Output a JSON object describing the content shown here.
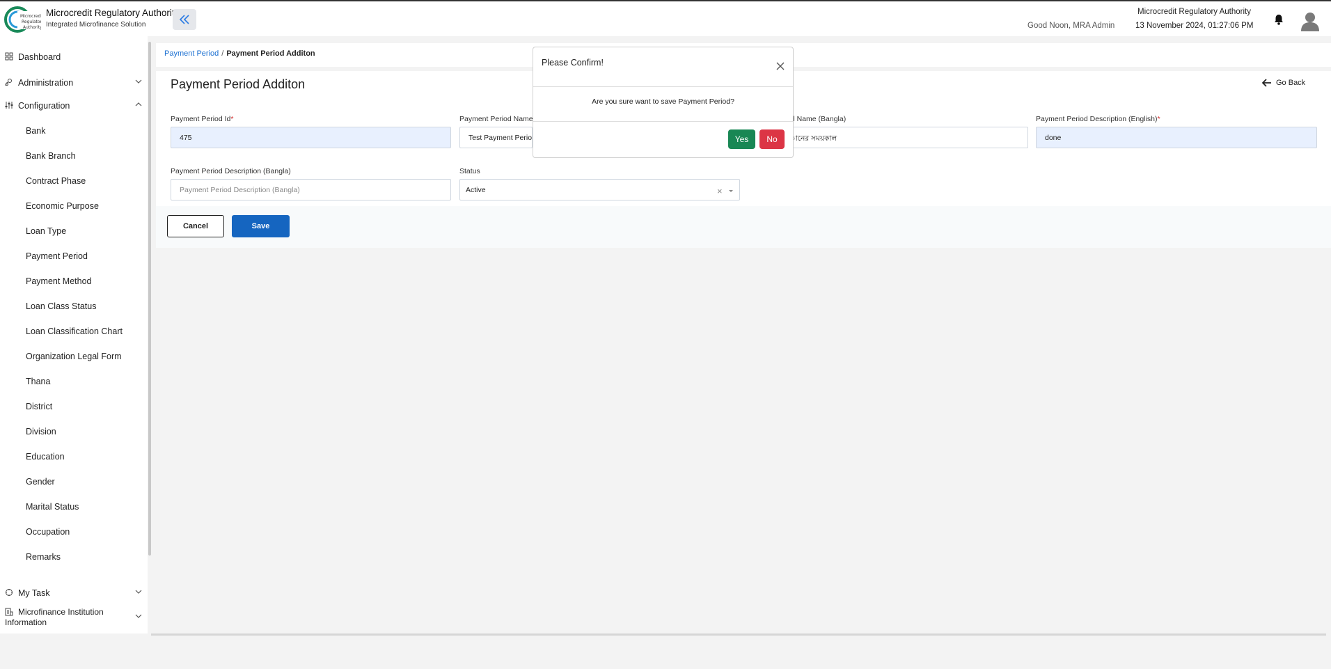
{
  "header": {
    "app_title": "Microcredit Regulatory Authority",
    "app_subtitle": "Integrated Microfinance Solution",
    "greeting": "Good Noon, MRA Admin",
    "org_name": "Microcredit Regulatory Authority",
    "datetime": "13 November 2024, 01:27:06 PM"
  },
  "sidebar": {
    "top": [
      {
        "label": "Dashboard",
        "icon": "dashboard-icon"
      },
      {
        "label": "Administration",
        "icon": "admin-icon"
      },
      {
        "label": "Configuration",
        "icon": "configuration-icon"
      }
    ],
    "configuration_items": [
      "Bank",
      "Bank Branch",
      "Contract Phase",
      "Economic Purpose",
      "Loan Type",
      "Payment Period",
      "Payment Method",
      "Loan Class Status",
      "Loan Classification Chart",
      "Organization Legal Form",
      "Thana",
      "District",
      "Division",
      "Education",
      "Gender",
      "Marital Status",
      "Occupation",
      "Remarks"
    ],
    "my_task": "My Task",
    "mfi_line1": "Microfinance Institution",
    "mfi_line2": "Information"
  },
  "breadcrumb": {
    "parent": "Payment Period",
    "separator": "/",
    "current": "Payment Period Additon"
  },
  "page": {
    "title": "Payment Period Additon",
    "go_back": "Go Back"
  },
  "form": {
    "id_label": "Payment Period Id",
    "id_value": "475",
    "name_en_label": "Payment Period Name",
    "name_en_value": "Test Payment Period",
    "name_bn_label": "od Name (Bangla)",
    "name_bn_value": "ানের সময়কাল",
    "desc_en_label": "Payment Period Description (English)",
    "desc_en_value": "done",
    "desc_bn_label": "Payment Period Description (Bangla)",
    "desc_bn_placeholder": "Payment Period Description (Bangla)",
    "status_label": "Status",
    "status_value": "Active",
    "required_mark": "*"
  },
  "actions": {
    "cancel": "Cancel",
    "save": "Save"
  },
  "modal": {
    "title": "Please Confirm!",
    "message": "Are you sure want to save Payment Period?",
    "yes": "Yes",
    "no": "No"
  },
  "colors": {
    "primary": "#1565c0",
    "link": "#1a6fd1",
    "yes": "#198754",
    "no": "#dc3545",
    "logo": "#1a8a5a"
  }
}
